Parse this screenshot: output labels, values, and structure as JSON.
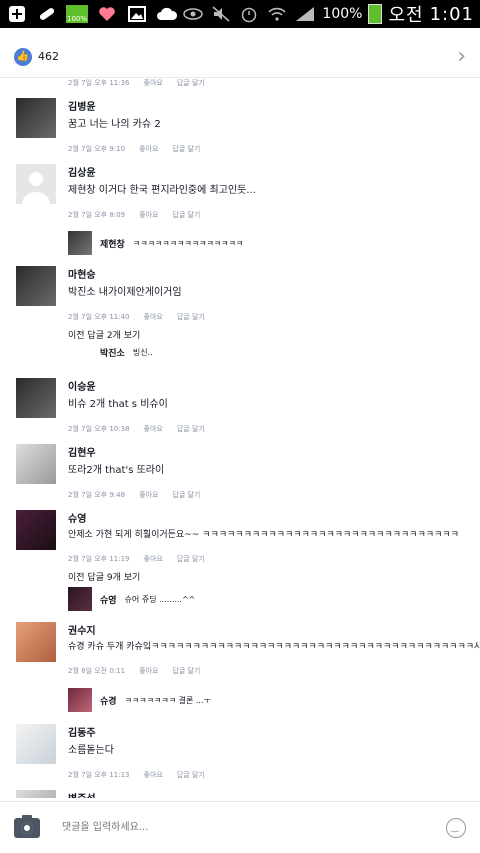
{
  "status_bar": {
    "battery_small_label": "100%",
    "battery_percent": "100%",
    "ampm": "오전",
    "time": "1:01"
  },
  "header": {
    "like_count": "462"
  },
  "first_meta": {
    "time": "2월 7일 오후 11:36",
    "like": "좋아요",
    "reply": "답글 달기"
  },
  "comments": [
    {
      "name": "김병윤",
      "text": "꿈고 너는 나의 카슈 2",
      "time": "2월 7일 오후 9:10",
      "like": "좋아요",
      "reply": "답글 달기"
    },
    {
      "name": "김상윤",
      "text": "제현창 이거다 한국 편지라인중에 최고인듯...",
      "time": "2월 7일 오후 8:09",
      "like": "좋아요",
      "reply": "답글 달기",
      "reply_item": {
        "name": "제현창",
        "text": "ㅋㅋㅋㅋㅋㅋㅋㅋㅋㅋㅋㅋㅋㅋㅋ"
      }
    },
    {
      "name": "마현승",
      "text": "박진소 내가이제안게이거임",
      "time": "2월 7일 오후 11:40",
      "like": "좋아요",
      "reply": "답글 달기",
      "more": "이전 답글 2개 보기",
      "reply_item": {
        "name": "박진소",
        "text": "빙신.."
      }
    },
    {
      "name": "이승윤",
      "text": "비슈 2개 that s 비슈이",
      "time": "2월 7일 오후 10:38",
      "like": "좋아요",
      "reply": "답글 달기"
    },
    {
      "name": "김현우",
      "text": "또라2개 that's 또라이",
      "time": "2월 7일 오후 9:48",
      "like": "좋아요",
      "reply": "답글 달기"
    },
    {
      "name": "슈영",
      "text": "안제소 가현 되게 히훨이거든요~~ ㅋㅋㅋㅋㅋㅋㅋㅋㅋㅋㅋㅋㅋㅋㅋㅋㅋㅋㅋㅋㅋㅋㅋㅋㅋㅋㅋㅋㅋㅋㅋ",
      "time": "2월 7일 오후 11:19",
      "like": "좋아요",
      "reply": "답글 달기",
      "more": "이전 답글 9개 보기",
      "reply_item": {
        "name": "슈영",
        "text": "슈어 쥬딩 .........^^"
      }
    },
    {
      "name": "권수지",
      "text": "슈경 카슈 두개 카슈잌ㅋㅋㅋㅋㅋㅋㅋㅋㅋㅋㅋㅋㅋㅋㅋㅋㅋㅋㅋㅋㅋㅋㅋㅋㅋㅋㅋㅋㅋㅋㅋㅋㅋㅋㅋㅋㅋㅋㅋ샤",
      "time": "2월 8일 오전 0:11",
      "like": "좋아요",
      "reply": "답글 달기",
      "reply_item": {
        "name": "슈경",
        "text": "ㅋㅋㅋㅋㅋㅋㅋ 결론 ...ㅜ"
      }
    },
    {
      "name": "김동주",
      "text": "소름돋는다",
      "time": "2월 7일 오후 11:13",
      "like": "좋아요",
      "reply": "답글 달기"
    },
    {
      "name": "변준석"
    }
  ],
  "input": {
    "placeholder": "댓글을 입력하세요..."
  }
}
